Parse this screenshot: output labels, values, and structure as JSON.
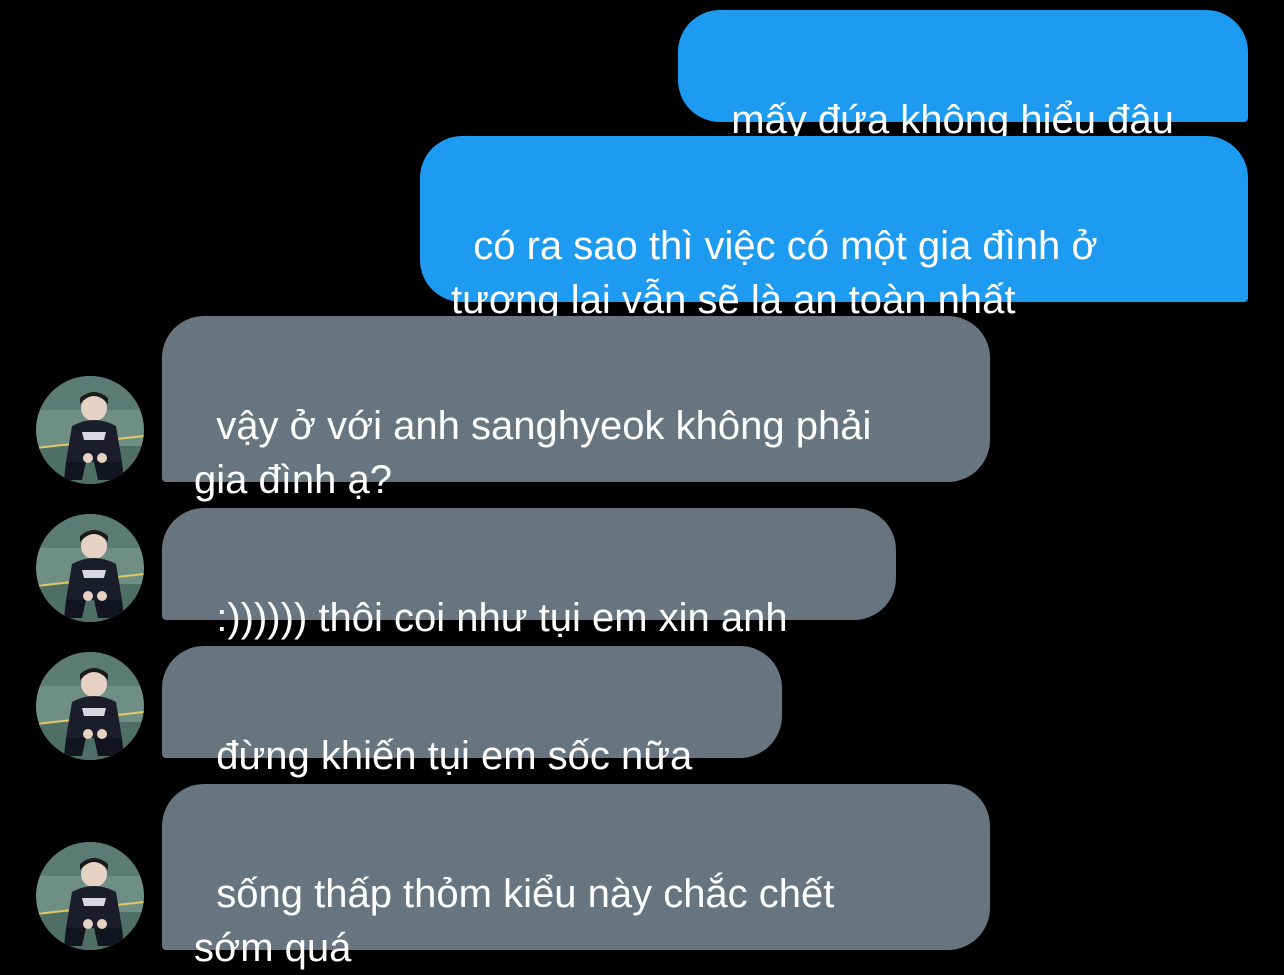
{
  "colors": {
    "background": "#000000",
    "outgoing_bubble": "#1d9bf0",
    "incoming_bubble": "#66757f",
    "text": "#ffffff"
  },
  "conversation": {
    "messages": [
      {
        "direction": "outgoing",
        "text": "mấy đứa không hiểu đâu"
      },
      {
        "direction": "outgoing",
        "text": "có ra sao thì việc có một gia đình ở\ntương lai vẫn sẽ là an toàn nhất"
      },
      {
        "direction": "incoming",
        "text": "vậy ở với anh sanghyeok không phải\ngia đình ạ?",
        "avatar_icon": "user-avatar-icon"
      },
      {
        "direction": "incoming",
        "text": ":)))))) thôi coi như tụi em xin anh",
        "avatar_icon": "user-avatar-icon"
      },
      {
        "direction": "incoming",
        "text": "đừng khiến tụi em sốc nữa",
        "avatar_icon": "user-avatar-icon"
      },
      {
        "direction": "incoming",
        "text": "sống thấp thỏm kiểu này chắc chết\nsớm quá",
        "avatar_icon": "user-avatar-icon"
      }
    ]
  }
}
